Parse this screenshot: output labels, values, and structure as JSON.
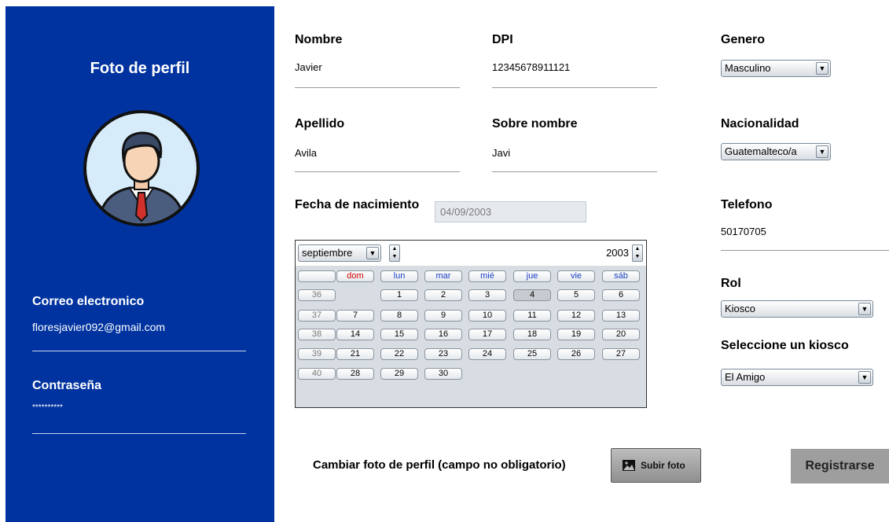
{
  "sidebar": {
    "title": "Foto de perfil",
    "email_label": "Correo electronico",
    "email_value": "floresjavier092@gmail.com",
    "password_label": "Contraseña",
    "password_value": "**********",
    "background_color": "#0033a0"
  },
  "form": {
    "nombre": {
      "label": "Nombre",
      "value": "Javier"
    },
    "dpi": {
      "label": "DPI",
      "value": "12345678911121"
    },
    "genero": {
      "label": "Genero",
      "value": "Masculino"
    },
    "apellido": {
      "label": "Apellido",
      "value": "Avila"
    },
    "sobrenombre": {
      "label": "Sobre nombre",
      "value": "Javi"
    },
    "nacionalidad": {
      "label": "Nacionalidad",
      "value": "Guatemalteco/a"
    },
    "fecha": {
      "label": "Fecha de nacimiento",
      "value": "04/09/2003"
    },
    "telefono": {
      "label": "Telefono",
      "value": "50170705"
    },
    "rol": {
      "label": "Rol",
      "value": "Kiosco"
    },
    "kiosco": {
      "label": "Seleccione un kiosco",
      "value": "El Amigo"
    }
  },
  "calendar": {
    "month": "septiembre",
    "year": "2003",
    "day_names": [
      "dom",
      "lun",
      "mar",
      "mié",
      "jue",
      "vie",
      "sáb"
    ],
    "weeks": [
      {
        "week": "36",
        "days": [
          "",
          "1",
          "2",
          "3",
          "4",
          "5",
          "6"
        ]
      },
      {
        "week": "37",
        "days": [
          "7",
          "8",
          "9",
          "10",
          "11",
          "12",
          "13"
        ]
      },
      {
        "week": "38",
        "days": [
          "14",
          "15",
          "16",
          "17",
          "18",
          "19",
          "20"
        ]
      },
      {
        "week": "39",
        "days": [
          "21",
          "22",
          "23",
          "24",
          "25",
          "26",
          "27"
        ]
      },
      {
        "week": "40",
        "days": [
          "28",
          "29",
          "30",
          "",
          "",
          "",
          ""
        ]
      }
    ],
    "selected_day": "4"
  },
  "actions": {
    "change_photo_label": "Cambiar foto de perfil (campo no obligatorio)",
    "upload_label": "Subir foto",
    "upload_icon": "image-icon",
    "register_label": "Registrarse"
  }
}
